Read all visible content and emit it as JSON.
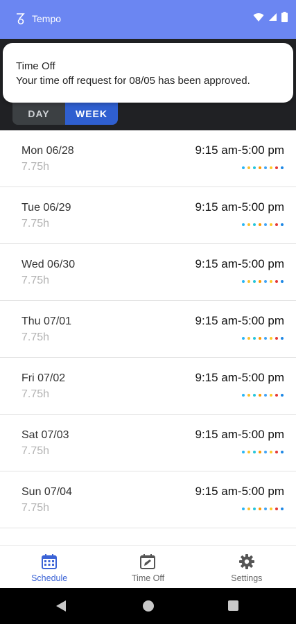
{
  "status_bar": {
    "app_name": "Tempo"
  },
  "notification": {
    "title": "Time Off",
    "body": "Your time off request for 08/05 has been approved."
  },
  "view_toggle": {
    "day_label": "DAY",
    "week_label": "WEEK",
    "selected": "WEEK"
  },
  "schedule": {
    "dot_colors": [
      "#29b6f6",
      "#fbc02d",
      "#26c6da",
      "#ff9800",
      "#42a5f5",
      "#ffca28",
      "#e53935",
      "#1e88e5"
    ],
    "rows": [
      {
        "date": "Mon 06/28",
        "hours": "7.75h",
        "time": "9:15 am-5:00 pm"
      },
      {
        "date": "Tue 06/29",
        "hours": "7.75h",
        "time": "9:15 am-5:00 pm"
      },
      {
        "date": "Wed 06/30",
        "hours": "7.75h",
        "time": "9:15 am-5:00 pm"
      },
      {
        "date": "Thu 07/01",
        "hours": "7.75h",
        "time": "9:15 am-5:00 pm"
      },
      {
        "date": "Fri 07/02",
        "hours": "7.75h",
        "time": "9:15 am-5:00 pm"
      },
      {
        "date": "Sat 07/03",
        "hours": "7.75h",
        "time": "9:15 am-5:00 pm"
      },
      {
        "date": "Sun 07/04",
        "hours": "7.75h",
        "time": "9:15 am-5:00 pm"
      }
    ]
  },
  "bottom_nav": {
    "items": [
      {
        "label": "Schedule",
        "icon": "calendar-icon",
        "active": true
      },
      {
        "label": "Time Off",
        "icon": "edit-calendar-icon",
        "active": false
      },
      {
        "label": "Settings",
        "icon": "gear-icon",
        "active": false
      }
    ]
  },
  "colors": {
    "accent": "#3b63d6",
    "header": "#6b86f2"
  }
}
